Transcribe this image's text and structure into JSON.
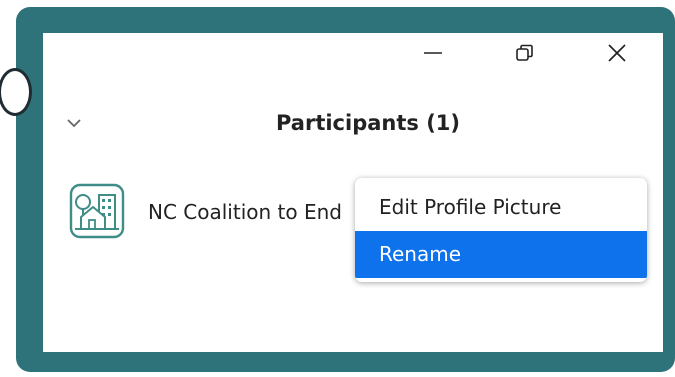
{
  "window_controls": {
    "minimize_icon": "minimize-icon",
    "restore_icon": "restore-icon",
    "close_icon": "close-icon"
  },
  "panel": {
    "title": "Participants (1)",
    "collapse_icon": "chevron-down-icon"
  },
  "participants": [
    {
      "name": "NC Coalition to End",
      "avatar_icon": "house-building-avatar-icon"
    }
  ],
  "context_menu": {
    "items": [
      {
        "label": "Edit Profile Picture",
        "selected": false
      },
      {
        "label": "Rename",
        "selected": true
      }
    ]
  },
  "colors": {
    "frame": "#2e7379",
    "selection": "#0e72ed",
    "avatar_stroke": "#3f8d87"
  }
}
